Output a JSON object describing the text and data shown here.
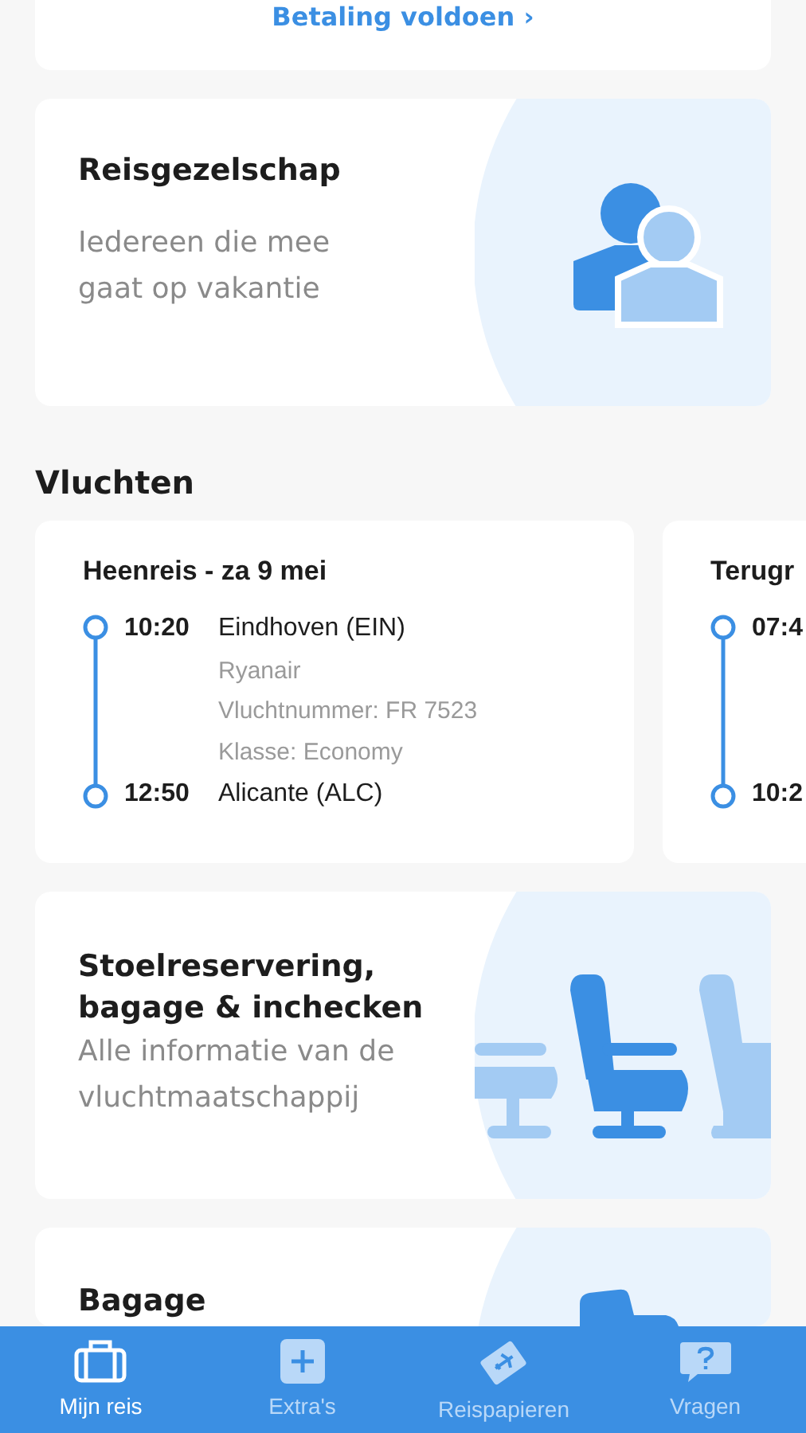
{
  "payment_link": {
    "label": "Betaling voldoen",
    "chevron": "›"
  },
  "travel_party": {
    "title": "Reisgezelschap",
    "description": "Iedereen die mee gaat op vakantie"
  },
  "flights_heading": "Vluchten",
  "flights": [
    {
      "title": "Heenreis - za 9 mei",
      "departure": {
        "time": "10:20",
        "place": "Eindhoven (EIN)"
      },
      "details": [
        "Ryanair",
        "Vluchtnummer: FR 7523",
        "Klasse: Economy"
      ],
      "arrival": {
        "time": "12:50",
        "place": "Alicante (ALC)"
      }
    },
    {
      "title": "Terugr",
      "departure": {
        "time": "07:4"
      },
      "arrival": {
        "time": "10:2"
      }
    }
  ],
  "seat_card": {
    "title": "Stoelreservering, bagage & inchecken",
    "description": "Alle informatie van de vluchtmaatschappij"
  },
  "baggage_card": {
    "title": "Bagage"
  },
  "tabs": [
    {
      "label": "Mijn reis",
      "selected": true
    },
    {
      "label": "Extra's",
      "selected": false
    },
    {
      "label": "Reispapieren",
      "selected": false
    },
    {
      "label": "Vragen",
      "selected": false
    }
  ]
}
